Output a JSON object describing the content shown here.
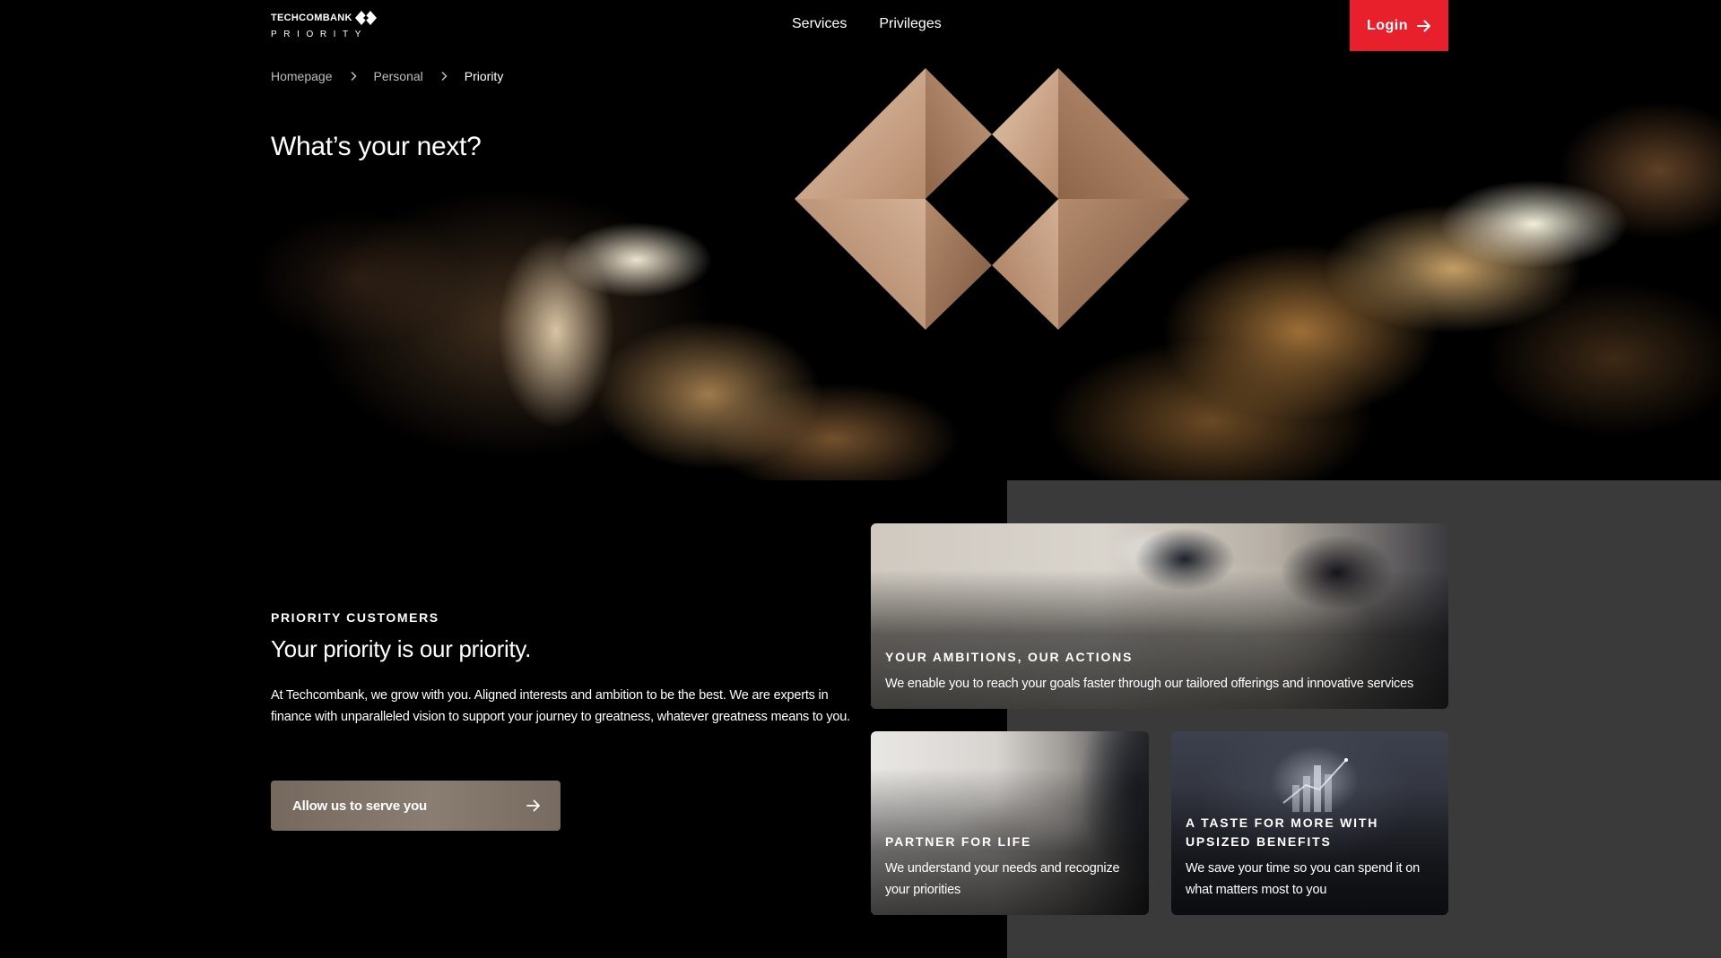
{
  "brand": {
    "name": "TECHCOMBANK",
    "sub": "PRIORITY"
  },
  "nav": {
    "items": [
      {
        "label": "Services"
      },
      {
        "label": "Privileges"
      }
    ],
    "login_label": "Login"
  },
  "breadcrumb": {
    "items": [
      {
        "label": "Homepage"
      },
      {
        "label": "Personal"
      },
      {
        "label": "Priority"
      }
    ]
  },
  "hero": {
    "title": "What’s your next?"
  },
  "intro": {
    "eyebrow": "PRIORITY CUSTOMERS",
    "title": "Your priority is our priority.",
    "body": "At Techcombank, we grow with you. Aligned interests and ambition to be the best. We are experts in finance with unparalleled vision to support your journey to greatness, whatever greatness means to you.",
    "cta_label": "Allow us to serve you"
  },
  "cards": [
    {
      "title": "YOUR AMBITIONS, OUR ACTIONS",
      "desc": "We enable you to reach your goals faster through our tailored offerings and innovative services"
    },
    {
      "title": "PARTNER FOR LIFE",
      "desc": "We understand your needs and recognize your priorities"
    },
    {
      "title": "A TASTE FOR MORE WITH UPSIZED BENEFITS",
      "desc": "We save your time so you can spend it on what matters most to you"
    }
  ],
  "colors": {
    "login_bg": "#e8202b",
    "page_bg": "#000000",
    "panel_grey": "#3a3a3a",
    "cta_bg": "#7f7368",
    "bronze": "#b0876a"
  },
  "icons": {
    "brand_mark": "techcombank-logo-icon",
    "login_arrow": "arrow-right-icon",
    "breadcrumb_sep": "chevron-right-icon",
    "cta_arrow": "arrow-right-icon",
    "emblem": "priority-emblem-icon"
  }
}
